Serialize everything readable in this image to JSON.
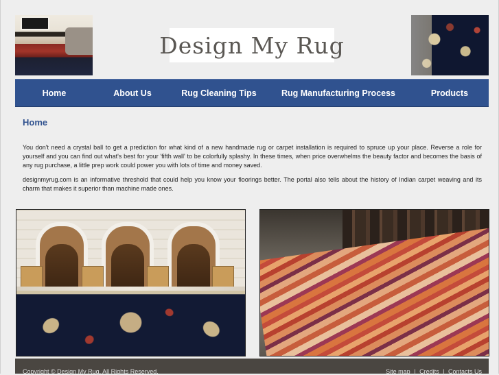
{
  "header": {
    "logo_text": "Design My Rug"
  },
  "nav": {
    "items": [
      {
        "label": "Home"
      },
      {
        "label": "About Us"
      },
      {
        "label": "Rug Cleaning Tips"
      },
      {
        "label": "Rug Manufacturing Process"
      },
      {
        "label": "Products"
      }
    ]
  },
  "main": {
    "title": "Home",
    "paragraphs": [
      "You don't need a crystal ball to get a prediction for what kind of a new handmade rug or carpet installation is required to spruce up your place. Reverse a role for yourself and you can find out what's best for your 'fifth wall' to be colorfully splashy. In these times, when price overwhelms the beauty factor and becomes the basis of any rug purchase, a little prep work could power you with lots of time and money saved.",
      "designmyrug.com is an informative threshold that could help you know your floorings better. The portal also tells about the history of Indian carpet weaving and its charm that makes it superior than machine made ones."
    ]
  },
  "footer": {
    "copyright": "Copyright © Design My Rug. All Rights Reserved.",
    "links": [
      "Site map",
      "Credits",
      "Contacts Us"
    ],
    "separator": "|"
  }
}
